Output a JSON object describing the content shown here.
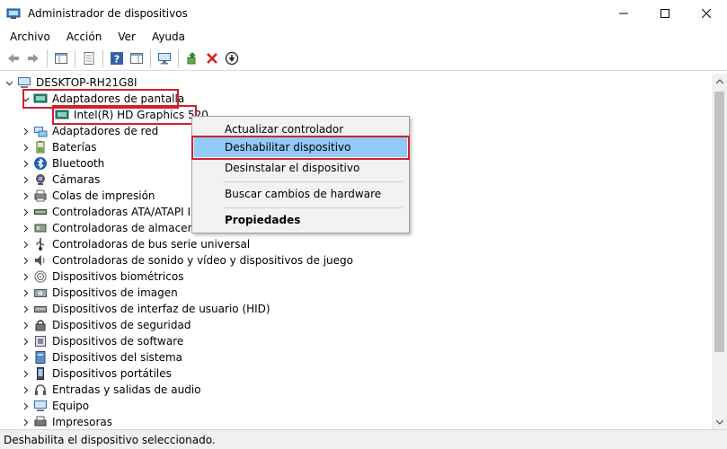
{
  "window": {
    "title": "Administrador de dispositivos"
  },
  "menu": [
    "Archivo",
    "Acción",
    "Ver",
    "Ayuda"
  ],
  "tree": {
    "root": "DESKTOP-RH21G8I",
    "expanded_category": "Adaptadores de pantalla",
    "selected_device": "Intel(R) HD Graphics 520",
    "categories": [
      {
        "label": "Adaptadores de red",
        "icon": "network-icon"
      },
      {
        "label": "Baterías",
        "icon": "battery-icon"
      },
      {
        "label": "Bluetooth",
        "icon": "bluetooth-icon"
      },
      {
        "label": "Cámaras",
        "icon": "camera-icon"
      },
      {
        "label": "Colas de impresión",
        "icon": "print-queue-icon"
      },
      {
        "label": "Controladoras ATA/ATAPI IDE",
        "icon": "ide-icon"
      },
      {
        "label": "Controladoras de almacenamiento",
        "icon": "storage-icon"
      },
      {
        "label": "Controladoras de bus serie universal",
        "icon": "usb-icon"
      },
      {
        "label": "Controladoras de sonido y vídeo y dispositivos de juego",
        "icon": "sound-icon"
      },
      {
        "label": "Dispositivos biométricos",
        "icon": "fingerprint-icon"
      },
      {
        "label": "Dispositivos de imagen",
        "icon": "imaging-icon"
      },
      {
        "label": "Dispositivos de interfaz de usuario (HID)",
        "icon": "hid-icon"
      },
      {
        "label": "Dispositivos de seguridad",
        "icon": "security-icon"
      },
      {
        "label": "Dispositivos de software",
        "icon": "software-icon"
      },
      {
        "label": "Dispositivos del sistema",
        "icon": "system-icon"
      },
      {
        "label": "Dispositivos portátiles",
        "icon": "portable-icon"
      },
      {
        "label": "Entradas y salidas de audio",
        "icon": "audio-icon"
      },
      {
        "label": "Equipo",
        "icon": "computer-icon"
      },
      {
        "label": "Impresoras",
        "icon": "printer-icon"
      }
    ]
  },
  "context_menu": {
    "items": [
      "Actualizar controlador",
      "Deshabilitar dispositivo",
      "Desinstalar el dispositivo",
      "Buscar cambios de hardware",
      "Propiedades"
    ]
  },
  "status": "Deshabilita el dispositivo seleccionado.",
  "colors": {
    "highlight_box": "#d0202e",
    "menu_hover": "#91c9f7"
  }
}
